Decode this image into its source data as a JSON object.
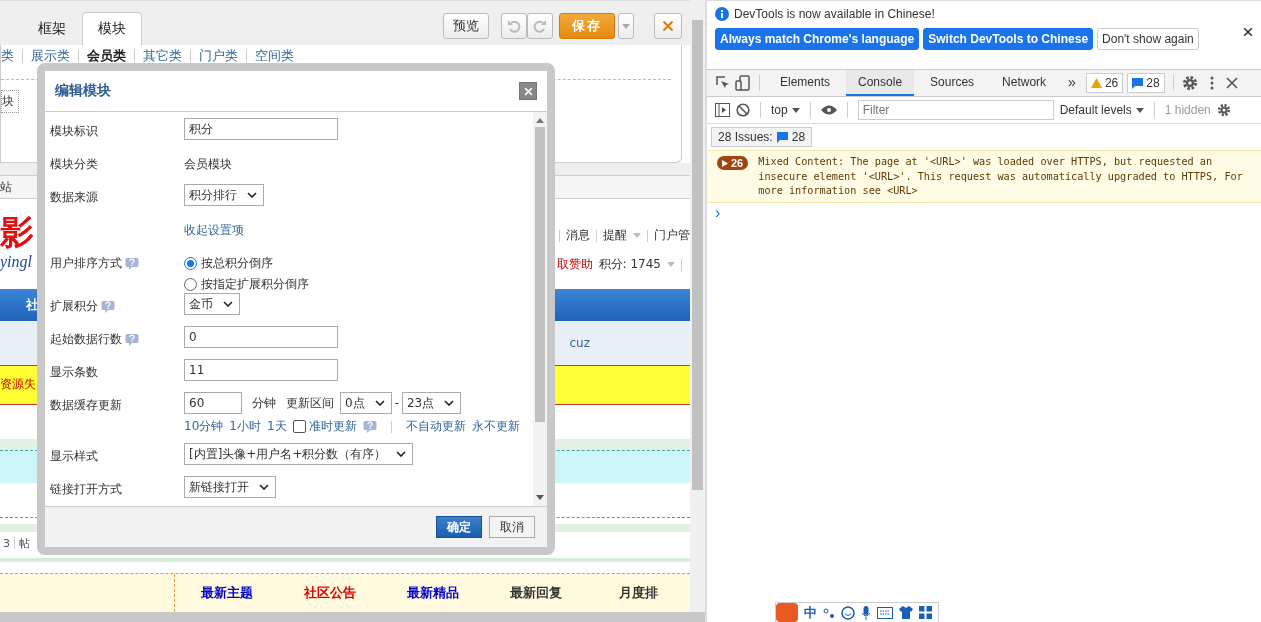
{
  "editor": {
    "tabs": [
      {
        "label": "框架",
        "selected": false
      },
      {
        "label": "模块",
        "selected": true
      }
    ],
    "preview_button": "预览",
    "save_button": "保存",
    "categories": [
      {
        "label": "类",
        "selected": false
      },
      {
        "label": "展示类",
        "selected": false
      },
      {
        "label": "会员类",
        "selected": true
      },
      {
        "label": "其它类",
        "selected": false
      },
      {
        "label": "门户类",
        "selected": false
      },
      {
        "label": "空间类",
        "selected": false
      }
    ],
    "module_chip": "块"
  },
  "page": {
    "breadcrumb": "站",
    "logo_text": "影",
    "logo_sub": "yingl",
    "user_links": [
      "消息",
      "提醒",
      "门户管"
    ],
    "sponsor": "取赞助",
    "points": "积分: 1745",
    "nav_item": "社",
    "row_text": "cuz",
    "notice": "资源失",
    "stats": [
      "3",
      "帖"
    ],
    "tabs": [
      {
        "label": "最新主题",
        "color": "#0000cc"
      },
      {
        "label": "社区公告",
        "color": "#dd0000"
      },
      {
        "label": "最新精品",
        "color": "#0000cc"
      },
      {
        "label": "最新回复",
        "color": "#333333"
      },
      {
        "label": "月度排",
        "color": "#333333"
      }
    ]
  },
  "dialog": {
    "title": "编辑模块",
    "fields": [
      {
        "kind": "input",
        "label": "模块标识",
        "value": "积分"
      },
      {
        "kind": "text",
        "label": "模块分类",
        "value": "会员模块"
      },
      {
        "kind": "select",
        "label": "数据来源",
        "value": "积分排行"
      },
      {
        "kind": "link",
        "link": "收起设置项"
      },
      {
        "kind": "radio",
        "label": "用户排序方式",
        "help": true,
        "options": [
          {
            "label": "按总积分倒序",
            "selected": true
          },
          {
            "label": "按指定扩展积分倒序",
            "selected": false
          }
        ]
      },
      {
        "kind": "select",
        "label": "扩展积分",
        "help": true,
        "value": "金币"
      },
      {
        "kind": "input",
        "label": "起始数据行数",
        "help": true,
        "value": "0"
      },
      {
        "kind": "input",
        "label": "显示条数",
        "value": "11"
      },
      {
        "kind": "cache",
        "label": "数据缓存更新",
        "value": "60",
        "unit": "分钟",
        "range_label": "更新区间",
        "from": "0点",
        "range_sep": "-",
        "to": "23点",
        "presets": [
          "10分钟",
          "1小时",
          "1天"
        ],
        "on_time": {
          "label": "准时更新",
          "checked": false
        },
        "extra_links": [
          "不自动更新",
          "永不更新"
        ]
      },
      {
        "kind": "select",
        "label": "显示样式",
        "value": "[内置]头像+用户名+积分数（有序）",
        "wide": true
      },
      {
        "kind": "select",
        "label": "链接打开方式",
        "value": "新链接打开"
      }
    ],
    "ok_button": "确定",
    "cancel_button": "取消"
  },
  "devtools": {
    "notice": "DevTools is now available in Chinese!",
    "notice_buttons": [
      {
        "label": "Always match Chrome's language",
        "kind": "primary"
      },
      {
        "label": "Switch DevTools to Chinese",
        "kind": "primary"
      },
      {
        "label": "Don't show again",
        "kind": "plain"
      }
    ],
    "tabs": [
      {
        "label": "Elements",
        "selected": false
      },
      {
        "label": "Console",
        "selected": true
      },
      {
        "label": "Sources",
        "selected": false
      },
      {
        "label": "Network",
        "selected": false
      }
    ],
    "more": "»",
    "warnings": "26",
    "messages": "28",
    "context": "top",
    "filter_placeholder": "Filter",
    "levels": "Default levels",
    "hidden": "1 hidden",
    "issues": "28 Issues:",
    "issues_count": "28",
    "log": {
      "count": "26",
      "text": "Mixed Content: The page at '<URL>' was loaded over HTTPS, but requested an insecure element '<URL>'. This request was automatically upgraded to HTTPS, For more information see <URL>"
    },
    "prompt": "›"
  },
  "ime": {
    "mode": "中"
  }
}
